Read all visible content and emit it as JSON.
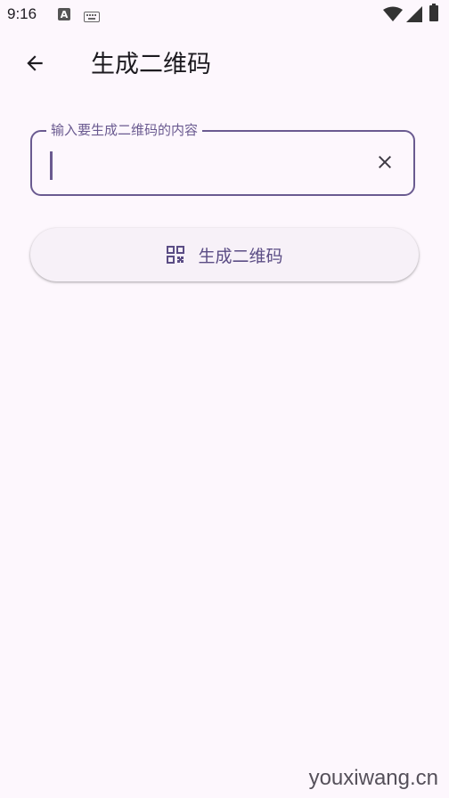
{
  "status_bar": {
    "time": "9:16",
    "icons": [
      "font-a-icon",
      "keyboard-icon",
      "wifi-icon",
      "signal-icon",
      "battery-icon"
    ]
  },
  "app_bar": {
    "back_icon": "arrow-left-icon",
    "title": "生成二维码"
  },
  "input": {
    "label": "输入要生成二维码的内容",
    "value": "",
    "clear_icon": "close-icon"
  },
  "generate_button": {
    "icon": "qr-code-icon",
    "label": "生成二维码"
  },
  "watermark": "youxiwang.cn",
  "colors": {
    "background": "#fdf7fd",
    "accent": "#6a5a90",
    "button_text": "#5b4d85",
    "button_bg": "#f7f1f8"
  }
}
